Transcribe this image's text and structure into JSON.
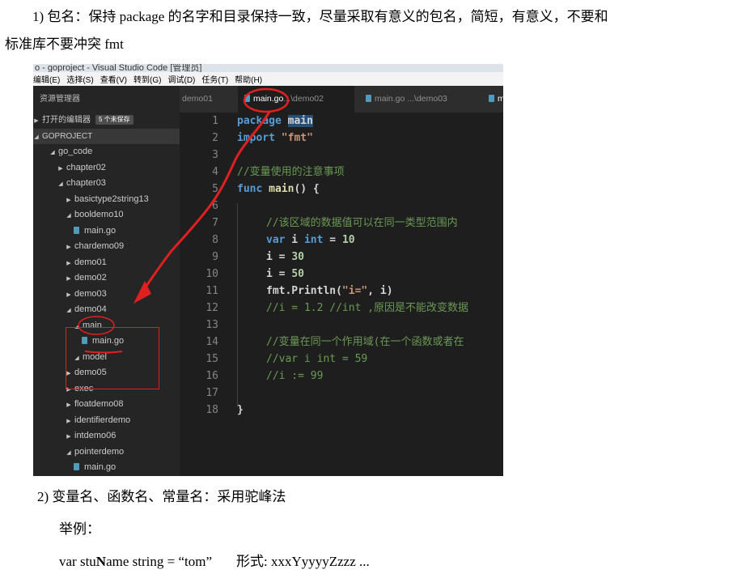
{
  "doc": {
    "p1_line1": "1) 包名：保持 package 的名字和目录保持一致，尽量采取有意义的包名，简短，有意义，不要和",
    "p1_line2": "标准库不要冲突  fmt",
    "p2": "2) 变量名、函数名、常量名：采用驼峰法",
    "p3": "举例：",
    "p4_pre": "var stu",
    "p4_bold": "N",
    "p4_mid": "ame string = “tom”",
    "p4_form": "形式: xxxYyyyyZzzz ..."
  },
  "window": {
    "title": "o - goproject - Visual Studio Code [管理员]",
    "menu": [
      "编辑(E)",
      "选择(S)",
      "查看(V)",
      "转到(G)",
      "调试(D)",
      "任务(T)",
      "帮助(H)"
    ]
  },
  "explorer": {
    "header": "资源管理器",
    "open_editors": "打开的编辑器",
    "unsaved_badge": "5 个未保存",
    "project": "GOPROJECT",
    "tree": [
      {
        "label": "go_code",
        "depth": 1,
        "kind": "folder-open"
      },
      {
        "label": "chapter02",
        "depth": 2,
        "kind": "folder"
      },
      {
        "label": "chapter03",
        "depth": 2,
        "kind": "folder-open"
      },
      {
        "label": "basictype2string13",
        "depth": 3,
        "kind": "folder"
      },
      {
        "label": "booldemo10",
        "depth": 3,
        "kind": "folder-open"
      },
      {
        "label": "main.go",
        "depth": 4,
        "kind": "file"
      },
      {
        "label": "chardemo09",
        "depth": 3,
        "kind": "folder"
      },
      {
        "label": "demo01",
        "depth": 3,
        "kind": "folder"
      },
      {
        "label": "demo02",
        "depth": 3,
        "kind": "folder"
      },
      {
        "label": "demo03",
        "depth": 3,
        "kind": "folder"
      },
      {
        "label": "demo04",
        "depth": 3,
        "kind": "folder-open"
      },
      {
        "label": "main",
        "depth": 4,
        "kind": "folder-open"
      },
      {
        "label": "main.go",
        "depth": 5,
        "kind": "file"
      },
      {
        "label": "model",
        "depth": 4,
        "kind": "folder-open"
      },
      {
        "label": "demo05",
        "depth": 3,
        "kind": "folder"
      },
      {
        "label": "exec",
        "depth": 3,
        "kind": "folder"
      },
      {
        "label": "floatdemo08",
        "depth": 3,
        "kind": "folder"
      },
      {
        "label": "identifierdemo",
        "depth": 3,
        "kind": "folder"
      },
      {
        "label": "intdemo06",
        "depth": 3,
        "kind": "folder"
      },
      {
        "label": "pointerdemo",
        "depth": 3,
        "kind": "folder-open"
      },
      {
        "label": "main.go",
        "depth": 4,
        "kind": "file"
      }
    ]
  },
  "tabs": [
    {
      "name": "demo01",
      "path": ""
    },
    {
      "name": "main.go",
      "path": "...\\demo02"
    },
    {
      "name": "main.go",
      "path": "...\\demo03"
    },
    {
      "name": "m",
      "path": ""
    }
  ],
  "editor": {
    "line_numbers": [
      "1",
      "2",
      "3",
      "4",
      "5",
      "6",
      "7",
      "8",
      "9",
      "10",
      "11",
      "12",
      "13",
      "14",
      "15",
      "16",
      "17",
      "18"
    ],
    "lines": {
      "l1_kw": "package",
      "l1_name": "main",
      "l2_kw": "import",
      "l2_str": "\"fmt\"",
      "l4": "//变量使用的注意事项",
      "l5_kw": "func",
      "l5_fn": "main",
      "l5_rest": "() {",
      "l7": "//该区域的数据值可以在同一类型范围内",
      "l8_kw": "var",
      "l8_id": " i ",
      "l8_type": "int",
      "l8_eq": " = ",
      "l8_num": "10",
      "l9_id": "i = ",
      "l9_num": "30",
      "l10_id": "i = ",
      "l10_num": "50",
      "l11_a": "fmt.Println(",
      "l11_str": "\"i=\"",
      "l11_b": ", i)",
      "l12": "//i = 1.2 //int ,原因是不能改变数据",
      "l14": "//变量在同一个作用域(在一个函数或者在",
      "l15": "//var i int = 59",
      "l16": "//i := 99",
      "l18": "}"
    }
  },
  "colors": {
    "annotation": "#e02020",
    "keyword": "#569cd6",
    "string": "#ce9178",
    "comment": "#6a9955",
    "number": "#b5cea8"
  }
}
